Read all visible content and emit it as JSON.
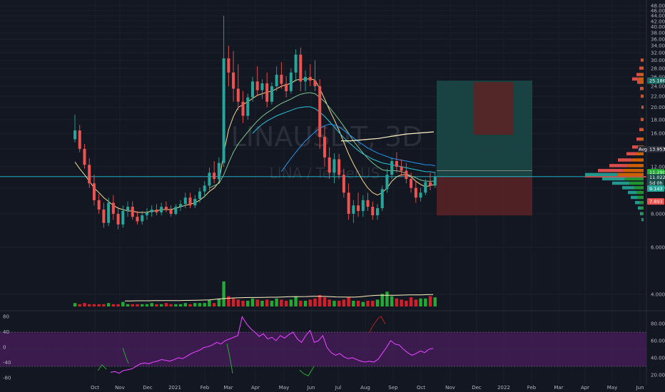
{
  "watermark": {
    "symbol": "LINAUSDT, 3D",
    "description": "LINA / TetherUS"
  },
  "colors": {
    "background": "#131722",
    "up": "#26a69a",
    "down": "#ef5350",
    "volume_up": "#22ab34",
    "volume_down": "#d41f2b",
    "rsi": "#e040fb",
    "rsi_band": "#4a1e5c",
    "ma_fast": "#f3d98e",
    "ma_mid": "#7ec58f",
    "ma_slow_a": "#26c6da",
    "ma_slow_b": "#2196f3",
    "volume_ma": "#fff3c4",
    "target_zone": "#1b4a48",
    "stop_zone": "#5a2326",
    "entry_line": "#26c6da"
  },
  "chart_data": [
    {
      "type": "candlestick",
      "title": "LINAUSDT, 3D",
      "price_axis_ticks": [
        "48.000",
        "46.000",
        "44.000",
        "42.000",
        "40.000",
        "38.000",
        "36.000",
        "34.000",
        "32.000",
        "30.000",
        "28.000",
        "26.000",
        "24.000",
        "22.000",
        "20.000",
        "18.000",
        "16.000",
        "14.000",
        "12.000",
        "10.000",
        "8.000",
        "6.000",
        "4.000"
      ],
      "price_scale": "log",
      "price_range": [
        4,
        48
      ],
      "time_axis": [
        "Oct",
        "Nov",
        "Dec",
        "2021",
        "Feb",
        "Mar",
        "Apr",
        "May",
        "Jun",
        "Jul",
        "Aug",
        "Sep",
        "Oct",
        "Nov",
        "Dec",
        "2022",
        "Feb",
        "Mar",
        "Apr",
        "May",
        "Jun"
      ],
      "price_tags": [
        {
          "label": "25.186",
          "color": "#1b6b64"
        },
        {
          "label": "13.953",
          "color": "#2a2e39",
          "prefix": "Avg"
        },
        {
          "label": "11.290",
          "color": "#22ab34"
        },
        {
          "label": "11.022",
          "color": "#1b4a48"
        },
        {
          "label": "5d 0h",
          "color": "#1b4a48"
        },
        {
          "label": "9.143",
          "color": "#26a69a"
        },
        {
          "label": "7.893",
          "color": "#ef5350"
        }
      ],
      "ohlc_series": [
        {
          "o": 15.2,
          "h": 18.8,
          "l": 14.8,
          "c": 16.4
        },
        {
          "o": 16.4,
          "h": 17.2,
          "l": 13.6,
          "c": 14.0
        },
        {
          "o": 14.0,
          "h": 14.6,
          "l": 11.8,
          "c": 12.2
        },
        {
          "o": 12.2,
          "h": 12.9,
          "l": 10.0,
          "c": 10.4
        },
        {
          "o": 10.4,
          "h": 11.2,
          "l": 8.6,
          "c": 9.0
        },
        {
          "o": 9.0,
          "h": 9.5,
          "l": 8.0,
          "c": 8.3
        },
        {
          "o": 8.3,
          "h": 8.8,
          "l": 7.1,
          "c": 7.4
        },
        {
          "o": 7.4,
          "h": 9.2,
          "l": 7.2,
          "c": 8.8
        },
        {
          "o": 8.8,
          "h": 9.4,
          "l": 7.6,
          "c": 8.0
        },
        {
          "o": 8.0,
          "h": 8.5,
          "l": 7.0,
          "c": 7.3
        },
        {
          "o": 7.3,
          "h": 8.6,
          "l": 7.1,
          "c": 8.2
        },
        {
          "o": 8.2,
          "h": 8.9,
          "l": 7.8,
          "c": 8.5
        },
        {
          "o": 8.5,
          "h": 8.9,
          "l": 7.6,
          "c": 7.8
        },
        {
          "o": 7.8,
          "h": 8.2,
          "l": 7.3,
          "c": 7.5
        },
        {
          "o": 7.5,
          "h": 8.2,
          "l": 7.3,
          "c": 7.9
        },
        {
          "o": 7.9,
          "h": 8.4,
          "l": 7.6,
          "c": 8.1
        },
        {
          "o": 8.1,
          "h": 8.6,
          "l": 7.8,
          "c": 8.3
        },
        {
          "o": 8.3,
          "h": 8.7,
          "l": 7.9,
          "c": 8.1
        },
        {
          "o": 8.1,
          "h": 8.8,
          "l": 7.9,
          "c": 8.5
        },
        {
          "o": 8.5,
          "h": 8.9,
          "l": 8.1,
          "c": 8.3
        },
        {
          "o": 8.3,
          "h": 8.6,
          "l": 7.8,
          "c": 8.0
        },
        {
          "o": 8.0,
          "h": 8.7,
          "l": 7.9,
          "c": 8.5
        },
        {
          "o": 8.5,
          "h": 9.0,
          "l": 8.2,
          "c": 8.7
        },
        {
          "o": 8.7,
          "h": 9.6,
          "l": 8.4,
          "c": 9.2
        },
        {
          "o": 9.2,
          "h": 9.6,
          "l": 8.4,
          "c": 8.6
        },
        {
          "o": 8.6,
          "h": 9.4,
          "l": 8.4,
          "c": 9.1
        },
        {
          "o": 9.1,
          "h": 10.0,
          "l": 8.8,
          "c": 9.7
        },
        {
          "o": 9.7,
          "h": 10.6,
          "l": 9.2,
          "c": 10.2
        },
        {
          "o": 10.2,
          "h": 11.9,
          "l": 9.8,
          "c": 11.4
        },
        {
          "o": 11.4,
          "h": 12.6,
          "l": 10.4,
          "c": 10.8
        },
        {
          "o": 10.8,
          "h": 13.0,
          "l": 10.6,
          "c": 12.4
        },
        {
          "o": 12.4,
          "h": 44.0,
          "l": 12.0,
          "c": 30.5
        },
        {
          "o": 30.5,
          "h": 34.0,
          "l": 24.0,
          "c": 27.0
        },
        {
          "o": 27.0,
          "h": 32.5,
          "l": 21.0,
          "c": 23.5
        },
        {
          "o": 23.5,
          "h": 29.0,
          "l": 19.5,
          "c": 21.0
        },
        {
          "o": 21.0,
          "h": 23.0,
          "l": 17.5,
          "c": 18.6
        },
        {
          "o": 18.6,
          "h": 22.5,
          "l": 18.0,
          "c": 21.8
        },
        {
          "o": 21.8,
          "h": 26.0,
          "l": 21.0,
          "c": 25.0
        },
        {
          "o": 25.0,
          "h": 28.5,
          "l": 22.0,
          "c": 23.2
        },
        {
          "o": 23.2,
          "h": 25.5,
          "l": 21.5,
          "c": 24.6
        },
        {
          "o": 24.6,
          "h": 27.0,
          "l": 20.0,
          "c": 21.0
        },
        {
          "o": 21.0,
          "h": 24.8,
          "l": 20.5,
          "c": 24.0
        },
        {
          "o": 24.0,
          "h": 28.5,
          "l": 23.0,
          "c": 26.5
        },
        {
          "o": 26.5,
          "h": 29.5,
          "l": 23.5,
          "c": 24.5
        },
        {
          "o": 24.5,
          "h": 26.2,
          "l": 21.8,
          "c": 23.0
        },
        {
          "o": 23.0,
          "h": 28.0,
          "l": 22.5,
          "c": 27.0
        },
        {
          "o": 27.0,
          "h": 33.0,
          "l": 25.0,
          "c": 31.5
        },
        {
          "o": 31.5,
          "h": 33.5,
          "l": 23.0,
          "c": 25.0
        },
        {
          "o": 25.0,
          "h": 27.5,
          "l": 23.0,
          "c": 26.0
        },
        {
          "o": 26.0,
          "h": 29.0,
          "l": 24.0,
          "c": 25.2
        },
        {
          "o": 25.2,
          "h": 30.0,
          "l": 23.0,
          "c": 24.0
        },
        {
          "o": 24.0,
          "h": 25.5,
          "l": 14.0,
          "c": 15.5
        },
        {
          "o": 15.5,
          "h": 17.0,
          "l": 12.0,
          "c": 13.0
        },
        {
          "o": 13.0,
          "h": 14.2,
          "l": 10.8,
          "c": 11.4
        },
        {
          "o": 11.4,
          "h": 13.5,
          "l": 10.4,
          "c": 12.8
        },
        {
          "o": 12.8,
          "h": 13.4,
          "l": 10.8,
          "c": 11.2
        },
        {
          "o": 11.2,
          "h": 11.8,
          "l": 9.2,
          "c": 9.6
        },
        {
          "o": 9.6,
          "h": 10.4,
          "l": 7.6,
          "c": 8.0
        },
        {
          "o": 8.0,
          "h": 9.0,
          "l": 7.4,
          "c": 8.6
        },
        {
          "o": 8.6,
          "h": 9.6,
          "l": 7.8,
          "c": 8.2
        },
        {
          "o": 8.2,
          "h": 9.4,
          "l": 7.8,
          "c": 9.0
        },
        {
          "o": 9.0,
          "h": 9.6,
          "l": 8.2,
          "c": 8.5
        },
        {
          "o": 8.5,
          "h": 8.9,
          "l": 7.6,
          "c": 7.9
        },
        {
          "o": 7.9,
          "h": 8.7,
          "l": 7.6,
          "c": 8.4
        },
        {
          "o": 8.4,
          "h": 10.2,
          "l": 8.2,
          "c": 9.9
        },
        {
          "o": 9.9,
          "h": 11.8,
          "l": 9.6,
          "c": 11.2
        },
        {
          "o": 11.2,
          "h": 13.0,
          "l": 10.8,
          "c": 12.6
        },
        {
          "o": 12.6,
          "h": 13.6,
          "l": 11.4,
          "c": 12.0
        },
        {
          "o": 12.0,
          "h": 12.8,
          "l": 11.0,
          "c": 11.6
        },
        {
          "o": 11.6,
          "h": 12.4,
          "l": 10.4,
          "c": 10.8
        },
        {
          "o": 10.8,
          "h": 11.4,
          "l": 9.6,
          "c": 10.0
        },
        {
          "o": 10.0,
          "h": 10.6,
          "l": 8.8,
          "c": 9.2
        },
        {
          "o": 9.2,
          "h": 10.0,
          "l": 8.9,
          "c": 9.6
        },
        {
          "o": 9.6,
          "h": 10.8,
          "l": 9.4,
          "c": 10.5
        },
        {
          "o": 10.5,
          "h": 11.4,
          "l": 9.8,
          "c": 10.2
        },
        {
          "o": 10.2,
          "h": 11.5,
          "l": 10.0,
          "c": 11.0
        }
      ],
      "volume_series": [
        3,
        2,
        3,
        2,
        2,
        2,
        2,
        3,
        2,
        2,
        4,
        2,
        2,
        2,
        2,
        2,
        3,
        2,
        2,
        3,
        2,
        2,
        2,
        3,
        2,
        3,
        3,
        3,
        6,
        3,
        7,
        22,
        9,
        7,
        6,
        5,
        5,
        7,
        6,
        5,
        6,
        5,
        7,
        6,
        5,
        6,
        9,
        5,
        5,
        6,
        7,
        10,
        8,
        6,
        5,
        5,
        6,
        8,
        5,
        5,
        4,
        5,
        5,
        6,
        11,
        13,
        9,
        7,
        6,
        5,
        8,
        6,
        7,
        7,
        9,
        8
      ],
      "volume_ma": [
        2.4,
        2.4,
        2.5,
        2.5,
        2.5,
        2.6,
        2.6,
        2.7,
        2.7,
        2.7,
        2.8,
        2.9,
        3.0,
        3.1,
        3.3,
        3.8,
        4.3,
        4.6,
        5.0,
        5.2,
        5.3,
        5.4,
        5.4,
        5.5,
        5.6,
        5.6,
        5.8,
        6.0,
        6.1,
        6.1,
        6.2,
        6.4,
        6.4,
        6.3,
        6.1,
        5.9,
        5.8,
        5.7,
        5.7,
        6.0,
        6.6,
        7.0,
        7.3,
        7.4,
        7.4,
        7.4,
        7.5,
        7.6,
        7.6,
        7.7,
        7.9,
        8.0
      ],
      "moving_averages": [
        {
          "values": [
            12.5,
            11.8,
            11.2,
            10.6,
            10.0,
            9.6,
            9.2,
            8.9,
            8.6,
            8.4,
            8.3,
            8.2,
            8.2,
            8.1,
            8.1,
            8.1,
            8.2,
            8.2,
            8.3,
            8.3,
            8.3,
            8.4,
            8.5,
            8.6,
            8.7,
            8.8,
            9.0,
            9.3,
            9.7,
            10.0,
            10.5,
            13.5,
            16.5,
            18.5,
            20.0,
            20.5,
            21.0,
            21.6,
            22.2,
            22.5,
            22.8,
            23.0,
            23.5,
            24.0,
            24.3,
            24.6,
            25.3,
            25.5,
            25.5,
            25.6,
            25.3,
            23.5,
            21.5,
            19.6,
            18.0,
            16.4,
            14.8,
            13.4,
            12.3,
            11.4,
            10.6,
            10.0,
            9.6,
            9.4,
            9.6,
            10.0,
            10.6,
            11.0,
            11.2,
            11.2,
            11.0,
            10.6,
            10.3,
            10.1,
            10.2,
            10.3
          ]
        },
        {
          "values": [
            null,
            null,
            null,
            null,
            null,
            null,
            null,
            null,
            null,
            null,
            null,
            null,
            null,
            null,
            null,
            null,
            null,
            null,
            null,
            null,
            null,
            null,
            null,
            null,
            null,
            null,
            null,
            null,
            10.0,
            10.2,
            10.4,
            11.2,
            12.4,
            13.6,
            14.6,
            15.4,
            16.2,
            17.0,
            17.8,
            18.5,
            19.1,
            19.6,
            20.2,
            20.7,
            21.1,
            21.5,
            22.0,
            22.4,
            22.6,
            22.7,
            22.5,
            21.8,
            21.0,
            20.0,
            19.0,
            18.0,
            17.0,
            16.0,
            15.0,
            14.2,
            13.5,
            12.9,
            12.4,
            12.0,
            11.7,
            11.6,
            11.6,
            11.6,
            11.5,
            11.3,
            11.1,
            10.9,
            10.7,
            10.6,
            10.6,
            10.6
          ]
        },
        {
          "values": [
            null,
            null,
            null,
            null,
            null,
            null,
            null,
            null,
            null,
            null,
            null,
            null,
            null,
            null,
            null,
            null,
            null,
            null,
            null,
            null,
            null,
            null,
            null,
            null,
            null,
            null,
            null,
            null,
            null,
            null,
            null,
            null,
            null,
            null,
            null,
            null,
            null,
            16.0,
            16.7,
            17.3,
            17.8,
            18.2,
            18.6,
            18.9,
            19.2,
            19.5,
            19.8,
            20.0,
            20.1,
            20.1,
            19.8,
            19.2,
            18.5,
            17.7,
            16.9,
            16.1,
            15.4,
            14.8,
            14.3,
            13.8,
            13.4,
            13.1,
            12.8,
            12.6,
            12.4,
            12.3,
            12.2,
            12.1,
            12.0,
            11.9,
            11.8,
            11.7,
            11.6,
            11.5,
            11.5,
            11.4
          ]
        },
        {
          "values": [
            null,
            null,
            null,
            null,
            null,
            null,
            null,
            null,
            null,
            null,
            null,
            null,
            null,
            null,
            null,
            null,
            null,
            null,
            null,
            null,
            null,
            null,
            null,
            null,
            null,
            null,
            null,
            null,
            null,
            null,
            null,
            null,
            null,
            null,
            null,
            null,
            null,
            null,
            null,
            null,
            null,
            null,
            null,
            11.5,
            12.2,
            12.9,
            13.6,
            14.3,
            15.0,
            15.6,
            16.2,
            16.7,
            17.1,
            17.3,
            17.2,
            16.9,
            16.4,
            15.9,
            15.4,
            14.9,
            14.5,
            14.1,
            13.8,
            13.5,
            13.3,
            13.1,
            12.9,
            12.8,
            12.7,
            12.6,
            12.5,
            12.4,
            12.3,
            12.2,
            12.2,
            12.1
          ]
        }
      ],
      "vwap_line": [
        15.0,
        15.0,
        15.1,
        15.2,
        15.3,
        15.5,
        15.7,
        15.9,
        16.0,
        16.1,
        16.2
      ],
      "long_position": {
        "target": 25.186,
        "entry": 11.022,
        "stop": 7.893,
        "time_left": "5d 0h"
      },
      "current_price": 11.022
    },
    {
      "type": "line",
      "title": "RSI",
      "left_ticks": [
        "80",
        "40",
        "0",
        "-40",
        "-80"
      ],
      "right_ticks": [
        "80.00",
        "60.00",
        "40.00",
        "20.00"
      ],
      "band": [
        30,
        70
      ],
      "rsi_values": [
        23,
        24,
        22,
        25,
        26,
        27,
        30,
        33,
        34,
        33,
        35,
        36,
        38,
        37,
        36,
        38,
        40,
        39,
        42,
        45,
        47,
        49,
        52,
        53,
        55,
        58,
        56,
        60,
        62,
        64,
        66,
        88,
        80,
        74,
        70,
        65,
        68,
        62,
        64,
        60,
        66,
        63,
        67,
        70,
        62,
        58,
        66,
        72,
        58,
        60,
        66,
        52,
        46,
        43,
        45,
        41,
        39,
        40,
        38,
        36,
        35,
        36,
        35,
        38,
        45,
        52,
        60,
        56,
        55,
        50,
        46,
        43,
        45,
        48,
        46,
        50,
        51
      ],
      "oscillator_overlay": [
        {
          "color": "#22ab34",
          "values": [
            -60,
            -70,
            -75,
            -50
          ]
        },
        {
          "color": "#b71c1c",
          "values": [
            40,
            60,
            75,
            80,
            60
          ]
        }
      ]
    }
  ]
}
